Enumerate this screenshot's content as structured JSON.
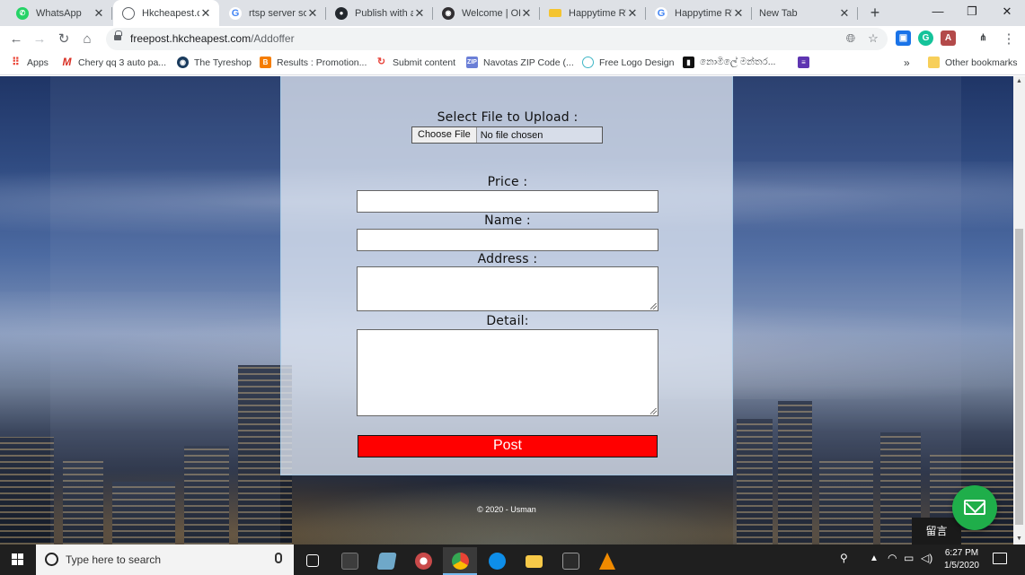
{
  "browser": {
    "tabs": [
      {
        "title": "WhatsApp",
        "icon": "whatsapp-icon",
        "color": "#25d366",
        "glyph": "✆"
      },
      {
        "title": "Hkcheapest.cc",
        "icon": "globe-icon",
        "color": "#5f6368",
        "glyph": "◍"
      },
      {
        "title": "rtsp server soft",
        "icon": "google-icon",
        "color": "#4285f4",
        "glyph": "G"
      },
      {
        "title": "Publish with a",
        "icon": "github-icon",
        "color": "#24292e",
        "glyph": "●"
      },
      {
        "title": "Welcome | OBS",
        "icon": "obs-icon",
        "color": "#302e31",
        "glyph": "◉"
      },
      {
        "title": "Happytime RTS",
        "icon": "folder-icon",
        "color": "#f4c430",
        "glyph": "▬"
      },
      {
        "title": "Happytime RTS",
        "icon": "google-icon",
        "color": "#4285f4",
        "glyph": "G"
      },
      {
        "title": "New Tab",
        "icon": "",
        "color": "",
        "glyph": ""
      }
    ],
    "active_tab": 1,
    "new_tab_label": "+",
    "window_controls": {
      "minimize": "—",
      "maximize": "❐",
      "close": "✕"
    },
    "url_host": "freepost.hkcheapest.com",
    "url_path": "/Addoffer",
    "bookmarks": [
      {
        "label": "Apps",
        "icon": "apps-grid-icon",
        "color": "#ea4335",
        "glyph": "⠿"
      },
      {
        "label": "Chery qq 3 auto pa...",
        "icon": "m-logo-icon",
        "color": "#d93025",
        "glyph": "M"
      },
      {
        "label": "The Tyreshop",
        "icon": "tyreshop-icon",
        "color": "#1a3b5d",
        "glyph": "◉"
      },
      {
        "label": "Results : Promotion...",
        "icon": "blogger-icon",
        "color": "#f57d00",
        "glyph": "B"
      },
      {
        "label": "Submit content",
        "icon": "submit-icon",
        "color": "#e8453c",
        "glyph": "↻"
      },
      {
        "label": "Navotas ZIP Code (...",
        "icon": "zip-icon",
        "color": "#6b7fd7",
        "glyph": "Z"
      },
      {
        "label": "Free Logo Design",
        "icon": "logo-design-icon",
        "color": "#3fb6c6",
        "glyph": "◌"
      },
      {
        "label": "නොමිලේ මන්තර...",
        "icon": "bookmark-page-icon",
        "color": "#111111",
        "glyph": "▮"
      },
      {
        "label": "",
        "icon": "list-icon",
        "color": "#5e35b1",
        "glyph": "≡"
      }
    ],
    "bookmarks_overflow": "»",
    "other_bookmarks": "Other bookmarks"
  },
  "form": {
    "file_label": "Select File to Upload :",
    "file_button": "Choose File",
    "file_status": "No file chosen",
    "price_label": "Price :",
    "price_value": "",
    "name_label": "Name :",
    "name_value": "",
    "address_label": "Address :",
    "address_value": "",
    "detail_label": "Detail:",
    "detail_value": "",
    "submit_label": "Post",
    "submit_color": "#ff0000"
  },
  "footer_text": "© 2020 - Usman",
  "chat_widget": {
    "label": "留言",
    "color": "#1fae4a"
  },
  "taskbar": {
    "search_placeholder": "Type here to search",
    "time": "6:27 PM",
    "date": "1/5/2020",
    "apps": [
      {
        "name": "task-view-icon",
        "color": "#ffffff"
      },
      {
        "name": "app-window-icon",
        "color": "#555555"
      },
      {
        "name": "app-blue-icon",
        "color": "#6fa8c9"
      },
      {
        "name": "app-red-icon",
        "color": "#c94a4a"
      },
      {
        "name": "chrome-icon",
        "color": "#fbbc05"
      },
      {
        "name": "teamviewer-icon",
        "color": "#0e8ee9"
      },
      {
        "name": "file-explorer-icon",
        "color": "#f7c948"
      },
      {
        "name": "terminal-icon",
        "color": "#2b2b2b"
      },
      {
        "name": "vlc-icon",
        "color": "#f08a00"
      }
    ]
  }
}
